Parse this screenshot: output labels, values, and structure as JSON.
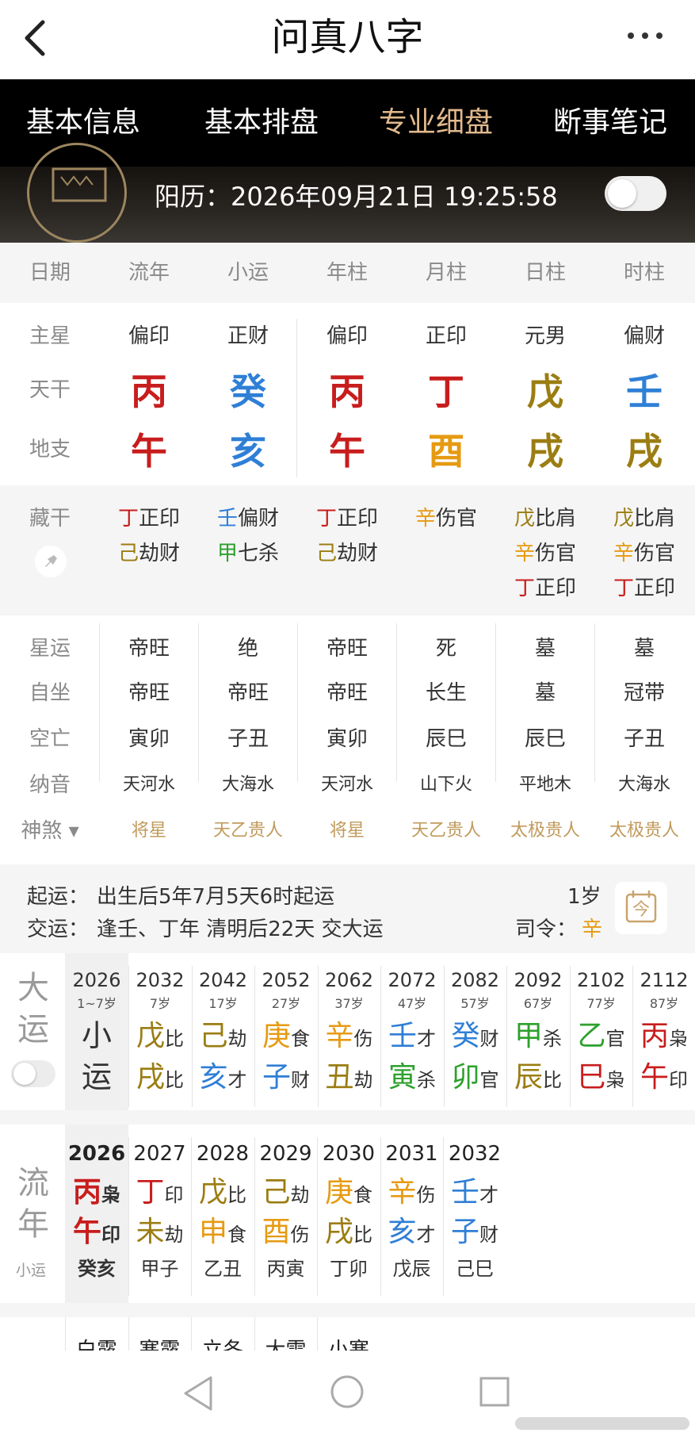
{
  "app": {
    "title": "问真八字"
  },
  "tabs": [
    "基本信息",
    "基本排盘",
    "专业细盘",
    "断事笔记"
  ],
  "banner": {
    "solar": "阳历：2026年09月21日 19:25:58"
  },
  "header": [
    "日期",
    "流年",
    "小运",
    "年柱",
    "月柱",
    "日柱",
    "时柱"
  ],
  "row_labels": {
    "star": "主星",
    "stem": "天干",
    "branch": "地支",
    "hidden": "藏干",
    "xingyun": "星运",
    "zizuo": "自坐",
    "kongwang": "空亡",
    "nayin": "纳音",
    "shensha": "神煞"
  },
  "main_star": [
    "偏印",
    "正财",
    "偏印",
    "正印",
    "元男",
    "偏财"
  ],
  "stems": [
    "丙",
    "癸",
    "丙",
    "丁",
    "戊",
    "壬"
  ],
  "branches": [
    "午",
    "亥",
    "午",
    "酉",
    "戌",
    "戌"
  ],
  "hidden": [
    [
      [
        "丁",
        "正印"
      ],
      [
        "己",
        "劫财"
      ]
    ],
    [
      [
        "壬",
        "偏财"
      ],
      [
        "甲",
        "七杀"
      ]
    ],
    [
      [
        "丁",
        "正印"
      ],
      [
        "己",
        "劫财"
      ]
    ],
    [
      [
        "辛",
        "伤官"
      ]
    ],
    [
      [
        "戊",
        "比肩"
      ],
      [
        "辛",
        "伤官"
      ],
      [
        "丁",
        "正印"
      ]
    ],
    [
      [
        "戊",
        "比肩"
      ],
      [
        "辛",
        "伤官"
      ],
      [
        "丁",
        "正印"
      ]
    ]
  ],
  "xingyun": [
    "帝旺",
    "绝",
    "帝旺",
    "死",
    "墓",
    "墓"
  ],
  "zizuo": [
    "帝旺",
    "帝旺",
    "帝旺",
    "长生",
    "墓",
    "冠带"
  ],
  "kongwang": [
    "寅卯",
    "子丑",
    "寅卯",
    "辰巳",
    "辰巳",
    "子丑"
  ],
  "nayin": [
    "天河水",
    "大海水",
    "天河水",
    "山下火",
    "平地木",
    "大海水"
  ],
  "shensha": [
    "将星",
    "天乙贵人",
    "将星",
    "天乙贵人",
    "太极贵人",
    "太极贵人"
  ],
  "qiyun": {
    "label1": "起运：",
    "text1": "出生后5年7月5天6时起运",
    "label2": "交运：",
    "text2": "逢壬、丁年 清明后22天 交大运",
    "age": "1岁",
    "siling_label": "司令：",
    "siling": "辛",
    "cal_char": "今"
  },
  "dayun": {
    "label": [
      "大",
      "运"
    ],
    "first": {
      "year": "2026",
      "age": "1~7岁",
      "chars": [
        "小",
        "运"
      ]
    },
    "cols": [
      {
        "year": "2032",
        "age": "7岁",
        "g": "戊",
        "gs": "比",
        "z": "戌",
        "zs": "比"
      },
      {
        "year": "2042",
        "age": "17岁",
        "g": "己",
        "gs": "劫",
        "z": "亥",
        "zs": "才"
      },
      {
        "year": "2052",
        "age": "27岁",
        "g": "庚",
        "gs": "食",
        "z": "子",
        "zs": "财"
      },
      {
        "year": "2062",
        "age": "37岁",
        "g": "辛",
        "gs": "伤",
        "z": "丑",
        "zs": "劫"
      },
      {
        "year": "2072",
        "age": "47岁",
        "g": "壬",
        "gs": "才",
        "z": "寅",
        "zs": "杀"
      },
      {
        "year": "2082",
        "age": "57岁",
        "g": "癸",
        "gs": "财",
        "z": "卯",
        "zs": "官"
      },
      {
        "year": "2092",
        "age": "67岁",
        "g": "甲",
        "gs": "杀",
        "z": "辰",
        "zs": "比"
      },
      {
        "year": "2102",
        "age": "77岁",
        "g": "乙",
        "gs": "官",
        "z": "巳",
        "zs": "枭"
      },
      {
        "year": "2112",
        "age": "87岁",
        "g": "丙",
        "gs": "枭",
        "z": "午",
        "zs": "印"
      }
    ]
  },
  "liunian": {
    "label": [
      "流",
      "年"
    ],
    "sub": "小运",
    "cols": [
      {
        "year": "2026",
        "g": "丙",
        "gs": "枭",
        "z": "午",
        "zs": "印",
        "xy": "癸亥"
      },
      {
        "year": "2027",
        "g": "丁",
        "gs": "印",
        "z": "未",
        "zs": "劫",
        "xy": "甲子"
      },
      {
        "year": "2028",
        "g": "戊",
        "gs": "比",
        "z": "申",
        "zs": "食",
        "xy": "乙丑"
      },
      {
        "year": "2029",
        "g": "己",
        "gs": "劫",
        "z": "酉",
        "zs": "伤",
        "xy": "丙寅"
      },
      {
        "year": "2030",
        "g": "庚",
        "gs": "食",
        "z": "戌",
        "zs": "比",
        "xy": "丁卯"
      },
      {
        "year": "2031",
        "g": "辛",
        "gs": "伤",
        "z": "亥",
        "zs": "才",
        "xy": "戊辰"
      },
      {
        "year": "2032",
        "g": "壬",
        "gs": "才",
        "z": "子",
        "zs": "财",
        "xy": "己巳"
      }
    ]
  },
  "jieqi": [
    "白露",
    "寒露",
    "立冬",
    "大雪",
    "小寒"
  ],
  "colors": {
    "red": "#c81d1d",
    "blue": "#2f7fd6",
    "orange": "#e69a12",
    "olive": "#9b7d12",
    "green": "#2ea02e",
    "accent": "#e2b98d",
    "gold": "#c19a5b"
  },
  "icons": [
    "back-arrow-icon",
    "more-dots-icon",
    "pin-icon",
    "calendar-icon",
    "nav-back-icon",
    "nav-home-icon",
    "nav-recent-icon"
  ]
}
